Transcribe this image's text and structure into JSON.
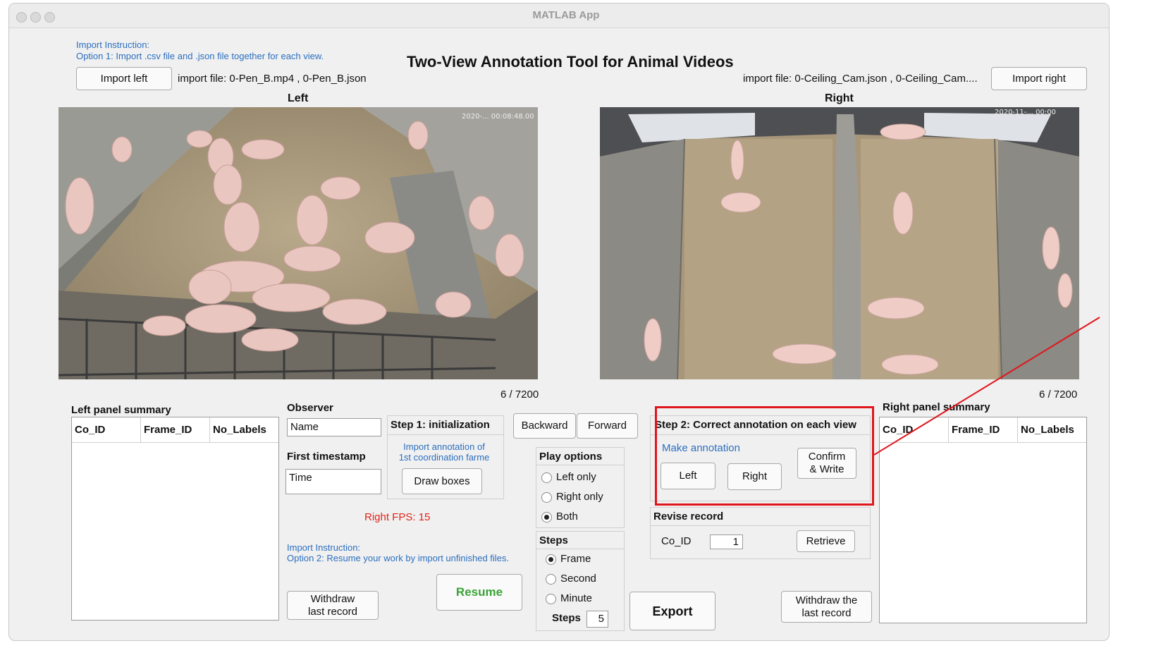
{
  "window": {
    "title": "MATLAB App"
  },
  "header": {
    "import_instruction": "Import Instruction:",
    "import_option1": "Option 1: Import .csv file and .json file together for each view.",
    "app_title": "Two-View Annotation Tool for Animal Videos",
    "import_left_label": "Import left",
    "left_file": "import file: 0-Pen_B.mp4 , 0-Pen_B.json",
    "right_file": "import file: 0-Ceiling_Cam.json , 0-Ceiling_Cam....",
    "import_right_label": "Import right"
  },
  "views": {
    "left": {
      "title": "Left",
      "counter": "6  /  7200",
      "timestamp": "2020-... 00:08:48.00"
    },
    "right": {
      "title": "Right",
      "counter": "6  /  7200",
      "timestamp": "2020-11-... 00:00"
    }
  },
  "left_summary": {
    "title": "Left panel summary",
    "columns": [
      "Co_ID",
      "Frame_ID",
      "No_Labels"
    ]
  },
  "right_summary": {
    "title": "Right panel summary",
    "columns": [
      "Co_ID",
      "Frame_ID",
      "No_Labels"
    ]
  },
  "observer": {
    "label": "Observer",
    "name_value": "Name",
    "first_timestamp_label": "First timestamp",
    "time_value": "Time"
  },
  "step1": {
    "title": "Step 1: initialization",
    "hint_line1": "Import annotation of",
    "hint_line2": "1st coordination farme",
    "draw_boxes": "Draw boxes"
  },
  "fps_text": "Right FPS: 15",
  "resume_info": {
    "instruction": "Import Instruction:",
    "option2": "Option 2: Resume your work by import unfinished files.",
    "resume_label": "Resume",
    "withdraw_line1": "Withdraw",
    "withdraw_line2": "last record"
  },
  "navigation": {
    "backward": "Backward",
    "forward": "Forward"
  },
  "play_options": {
    "title": "Play options",
    "options": [
      "Left only",
      "Right only",
      "Both"
    ],
    "selected": "Both"
  },
  "steps": {
    "title": "Steps",
    "options": [
      "Frame",
      "Second",
      "Minute"
    ],
    "selected": "Frame",
    "steps_label": "Steps",
    "steps_value": "5"
  },
  "export_label": "Export",
  "step2": {
    "title": "Step 2: Correct annotation on each view",
    "make_annotation": "Make annotation",
    "left_label": "Left",
    "right_label": "Right",
    "confirm_line1": "Confirm",
    "confirm_line2": "& Write",
    "highlight_color": "#e0161c"
  },
  "revise": {
    "title": "Revise record",
    "co_id_label": "Co_ID",
    "co_id_value": "1",
    "retrieve": "Retrieve"
  },
  "withdraw_record": {
    "line1": "Withdraw the",
    "line2": "last record"
  }
}
